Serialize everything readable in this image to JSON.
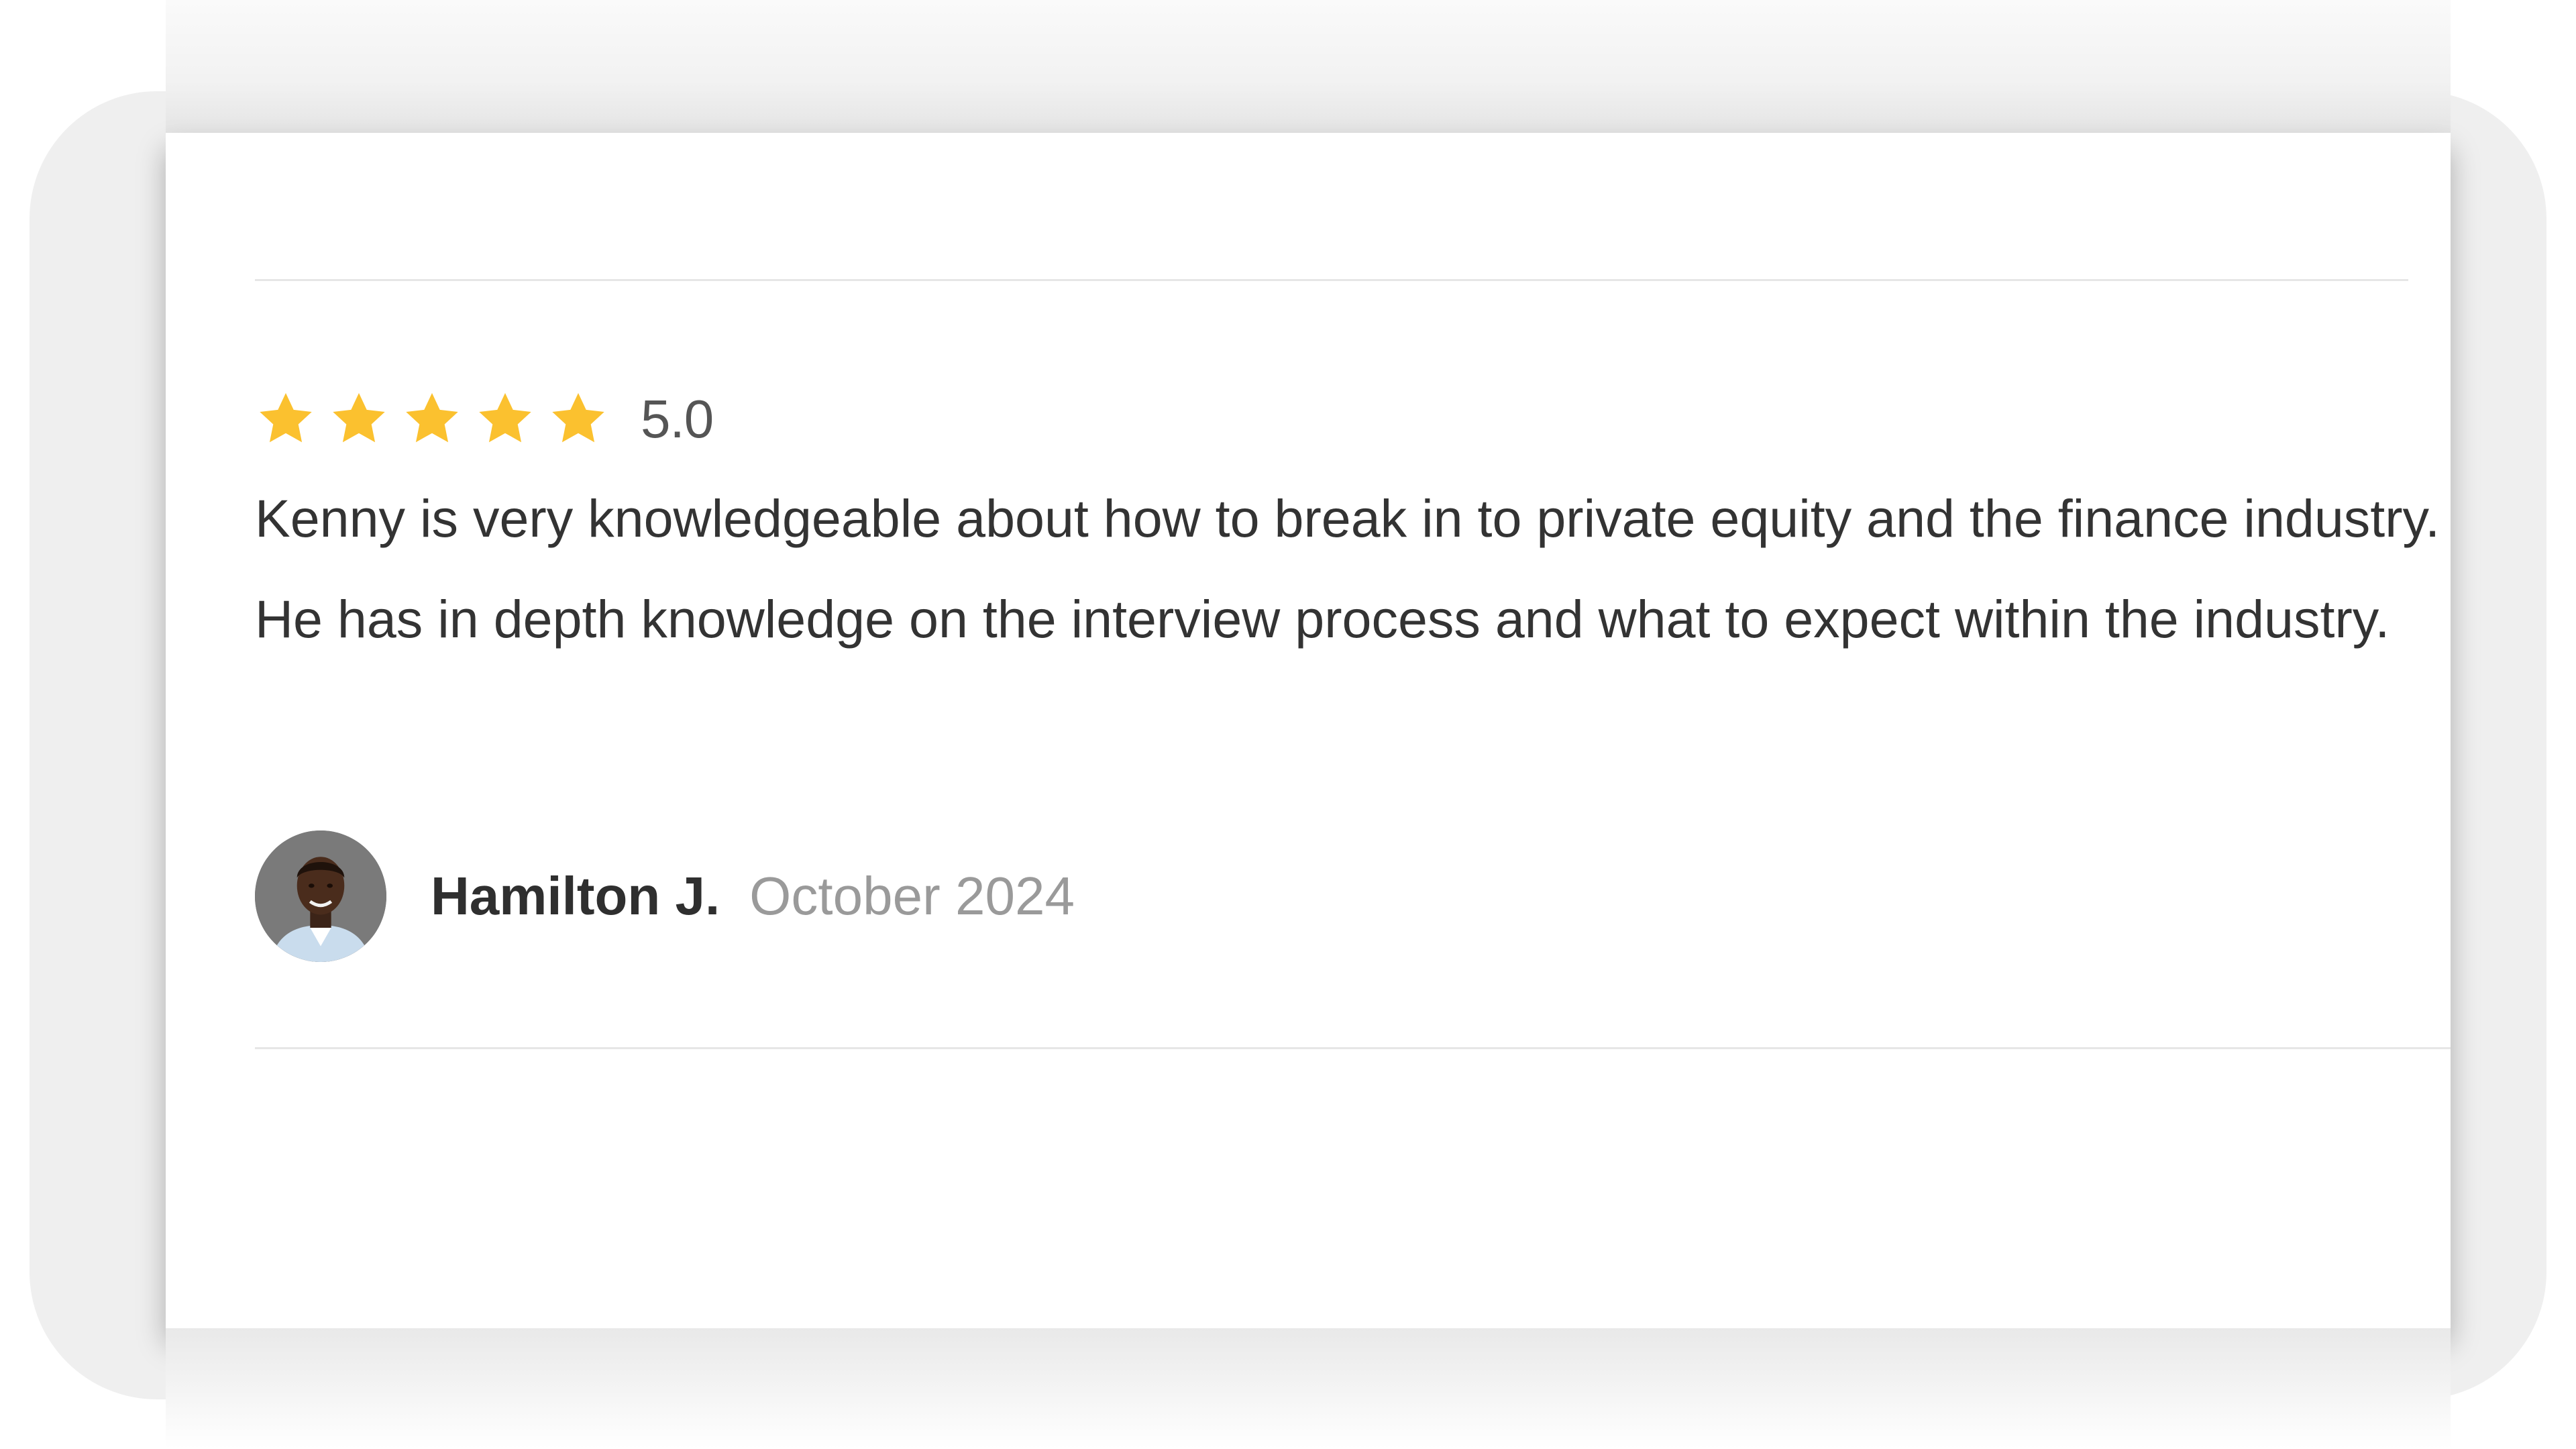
{
  "review": {
    "rating": 5,
    "rating_label": "5.0",
    "stars": [
      "star-filled",
      "star-filled",
      "star-filled",
      "star-filled",
      "star-filled"
    ],
    "text": "Kenny is very knowledgeable about how to break in to private equity and the finance industry. He has in depth knowledge on the interview process and what to expect within the industry.",
    "author": {
      "name": "Hamilton J.",
      "avatar_icon": "user-avatar-photo"
    },
    "date": "October 2024"
  },
  "colors": {
    "star": "#fbc12f",
    "text": "#333333",
    "muted": "#9a9a9a",
    "divider": "#e6e6e6",
    "frame": "#efefef"
  }
}
